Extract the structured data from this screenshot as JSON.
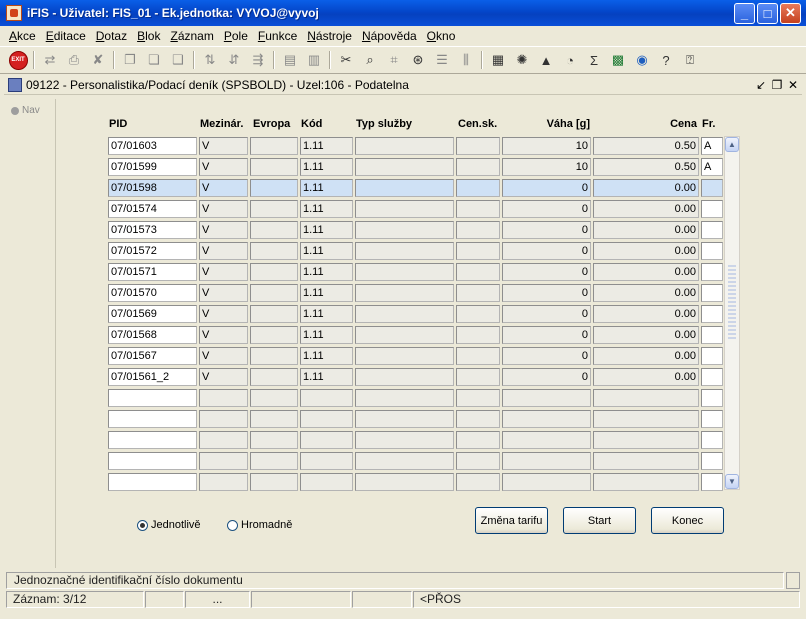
{
  "window": {
    "title": "iFIS - Uživatel: FIS_01 - Ek.jednotka: VYVOJ@vyvoj",
    "colors": {
      "titlebar": "#0446c9",
      "selected_row": "#cfe1f5"
    }
  },
  "menu": [
    "Akce",
    "Editace",
    "Dotaz",
    "Blok",
    "Záznam",
    "Pole",
    "Funkce",
    "Nástroje",
    "Nápověda",
    "Okno"
  ],
  "toolbar": {
    "exit_label": "EXIT",
    "icons": [
      "exit-icon",
      "save-icon",
      "print-icon",
      "delete-icon",
      "open-icon",
      "copy-icon",
      "paste-icon",
      "sort-asc-icon",
      "sort-desc-icon",
      "filter-icon",
      "print-preview-icon",
      "export-icon",
      "cut-icon",
      "find-icon",
      "query-icon",
      "execute-icon",
      "list-icon",
      "calculator-icon",
      "settings-icon",
      "warning-icon",
      "clock-icon",
      "sum-icon",
      "excel-icon",
      "browser-icon",
      "help-icon",
      "context-help-icon"
    ]
  },
  "form": {
    "title": "09122 - Personalistika/Podací deník (SPSBOLD) - Uzel:106 - Podatelna",
    "nav_label": "Nav",
    "columns": {
      "pid": "PID",
      "mezinar": "Mezinár.",
      "evropa": "Evropa",
      "kod": "Kód",
      "typ": "Typ služby",
      "censk": "Cen.sk.",
      "vaha": "Váha [g]",
      "cena": "Cena",
      "fr": "Fr."
    },
    "rows": [
      {
        "pid": "07/01603",
        "mezinar": "V",
        "evropa": "",
        "kod": "1.11",
        "typ": "",
        "censk": "",
        "vaha": "10",
        "cena": "0.50",
        "fr": "A"
      },
      {
        "pid": "07/01599",
        "mezinar": "V",
        "evropa": "",
        "kod": "1.11",
        "typ": "",
        "censk": "",
        "vaha": "10",
        "cena": "0.50",
        "fr": "A"
      },
      {
        "pid": "07/01598",
        "mezinar": "V",
        "evropa": "",
        "kod": "1.11",
        "typ": "",
        "censk": "",
        "vaha": "0",
        "cena": "0.00",
        "fr": ""
      },
      {
        "pid": "07/01574",
        "mezinar": "V",
        "evropa": "",
        "kod": "1.11",
        "typ": "",
        "censk": "",
        "vaha": "0",
        "cena": "0.00",
        "fr": ""
      },
      {
        "pid": "07/01573",
        "mezinar": "V",
        "evropa": "",
        "kod": "1.11",
        "typ": "",
        "censk": "",
        "vaha": "0",
        "cena": "0.00",
        "fr": ""
      },
      {
        "pid": "07/01572",
        "mezinar": "V",
        "evropa": "",
        "kod": "1.11",
        "typ": "",
        "censk": "",
        "vaha": "0",
        "cena": "0.00",
        "fr": ""
      },
      {
        "pid": "07/01571",
        "mezinar": "V",
        "evropa": "",
        "kod": "1.11",
        "typ": "",
        "censk": "",
        "vaha": "0",
        "cena": "0.00",
        "fr": ""
      },
      {
        "pid": "07/01570",
        "mezinar": "V",
        "evropa": "",
        "kod": "1.11",
        "typ": "",
        "censk": "",
        "vaha": "0",
        "cena": "0.00",
        "fr": ""
      },
      {
        "pid": "07/01569",
        "mezinar": "V",
        "evropa": "",
        "kod": "1.11",
        "typ": "",
        "censk": "",
        "vaha": "0",
        "cena": "0.00",
        "fr": ""
      },
      {
        "pid": "07/01568",
        "mezinar": "V",
        "evropa": "",
        "kod": "1.11",
        "typ": "",
        "censk": "",
        "vaha": "0",
        "cena": "0.00",
        "fr": ""
      },
      {
        "pid": "07/01567",
        "mezinar": "V",
        "evropa": "",
        "kod": "1.11",
        "typ": "",
        "censk": "",
        "vaha": "0",
        "cena": "0.00",
        "fr": ""
      },
      {
        "pid": "07/01561_2",
        "mezinar": "V",
        "evropa": "",
        "kod": "1.11",
        "typ": "",
        "censk": "",
        "vaha": "0",
        "cena": "0.00",
        "fr": ""
      },
      {
        "pid": "",
        "mezinar": "",
        "evropa": "",
        "kod": "",
        "typ": "",
        "censk": "",
        "vaha": "",
        "cena": "",
        "fr": ""
      },
      {
        "pid": "",
        "mezinar": "",
        "evropa": "",
        "kod": "",
        "typ": "",
        "censk": "",
        "vaha": "",
        "cena": "",
        "fr": ""
      },
      {
        "pid": "",
        "mezinar": "",
        "evropa": "",
        "kod": "",
        "typ": "",
        "censk": "",
        "vaha": "",
        "cena": "",
        "fr": ""
      },
      {
        "pid": "",
        "mezinar": "",
        "evropa": "",
        "kod": "",
        "typ": "",
        "censk": "",
        "vaha": "",
        "cena": "",
        "fr": ""
      },
      {
        "pid": "",
        "mezinar": "",
        "evropa": "",
        "kod": "",
        "typ": "",
        "censk": "",
        "vaha": "",
        "cena": "",
        "fr": ""
      }
    ],
    "selected_row": 2,
    "radios": [
      {
        "label": "Jednotlivě",
        "checked": true
      },
      {
        "label": "Hromadně",
        "checked": false
      }
    ],
    "buttons": {
      "zmena": "Změna tarifu",
      "start": "Start",
      "konec": "Konec"
    }
  },
  "status": {
    "hint": "Jednoznačné identifikační číslo dokumentu",
    "record": "Záznam: 3/12",
    "ellipsis": "...",
    "mode": "<PŘOS"
  }
}
